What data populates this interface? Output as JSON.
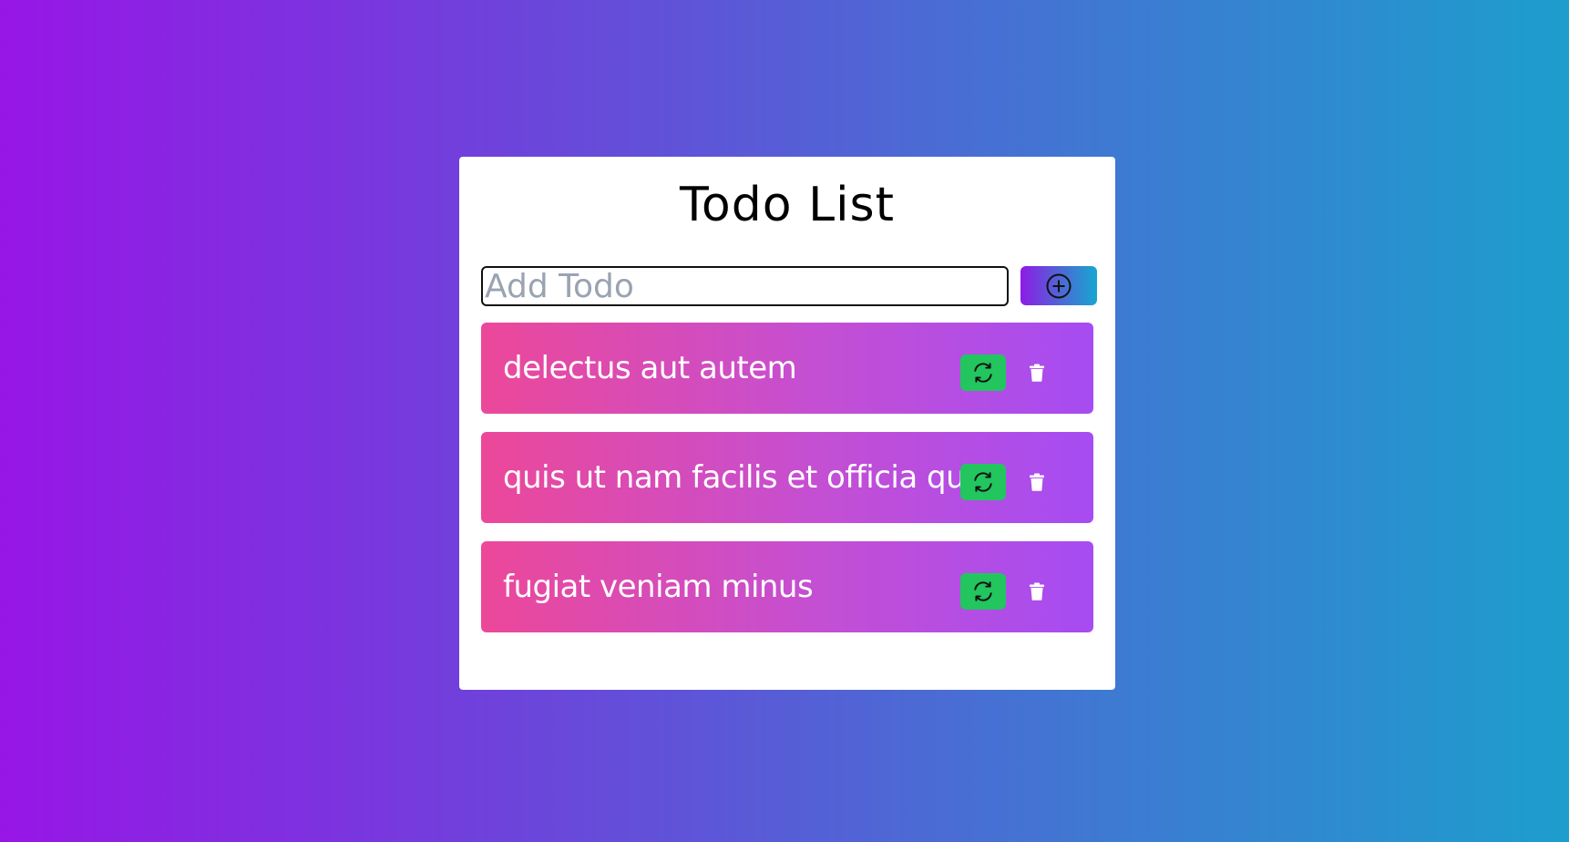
{
  "app": {
    "title": "Todo List"
  },
  "add": {
    "placeholder": "Add Todo",
    "value": "",
    "button_icon": "plus-circle-icon"
  },
  "todos": [
    {
      "text": "delectus aut autem",
      "refresh_icon": "refresh-icon",
      "delete_icon": "trash-icon"
    },
    {
      "text": "quis ut nam facilis et officia qui",
      "refresh_icon": "refresh-icon",
      "delete_icon": "trash-icon"
    },
    {
      "text": "fugiat veniam minus",
      "refresh_icon": "refresh-icon",
      "delete_icon": "trash-icon"
    }
  ],
  "colors": {
    "background_start": "#9716e6",
    "background_end": "#1d9ecd",
    "todo_start": "#ec4899",
    "todo_end": "#a64cf2",
    "refresh_button": "#22c55e"
  }
}
